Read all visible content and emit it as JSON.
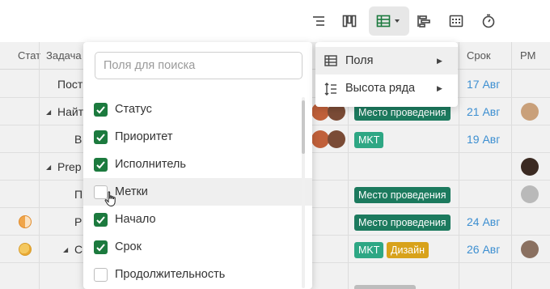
{
  "toolbar": {
    "icons": [
      "list-view-icon",
      "board-view-icon",
      "table-view-icon",
      "gantt-view-icon",
      "calendar-view-icon",
      "timer-icon"
    ],
    "accent": "#1c7a3e"
  },
  "grid": {
    "columns": {
      "status": "Стат",
      "task": "Задача",
      "due": "Срок",
      "pm": "PM"
    },
    "rows": [
      {
        "name": "Пост",
        "tags": [],
        "due": "17 Авг"
      },
      {
        "name": "Найт",
        "tags": [
          "Место проведения"
        ],
        "due": "21 Авг"
      },
      {
        "name": "В",
        "tags": [
          "MKT"
        ],
        "due": "19 Авг"
      },
      {
        "name": "Prep",
        "tags": [],
        "due": ""
      },
      {
        "name": "П",
        "tags": [
          "Место проведения"
        ],
        "due": ""
      },
      {
        "name": "Р",
        "tags": [
          "Место проведения"
        ],
        "due": "24 Авг"
      },
      {
        "name": "С",
        "tags": [
          "MKT",
          "Дизайн"
        ],
        "due": "26 Авг"
      }
    ]
  },
  "fields_panel": {
    "search_placeholder": "Поля для поиска",
    "items": [
      {
        "label": "Статус",
        "checked": true
      },
      {
        "label": "Приоритет",
        "checked": true
      },
      {
        "label": "Исполнитель",
        "checked": true
      },
      {
        "label": "Метки",
        "checked": false
      },
      {
        "label": "Начало",
        "checked": true
      },
      {
        "label": "Срок",
        "checked": true
      },
      {
        "label": "Продолжительность",
        "checked": false
      }
    ]
  },
  "view_menu": {
    "items": [
      {
        "label": "Поля",
        "icon": "table-icon"
      },
      {
        "label": "Высота ряда",
        "icon": "row-height-icon"
      }
    ]
  },
  "colors": {
    "tag_venue": "#1c7a5e",
    "tag_mkt": "#2ea784",
    "tag_design": "#d8a21b",
    "date_text": "#3d8fd1"
  }
}
